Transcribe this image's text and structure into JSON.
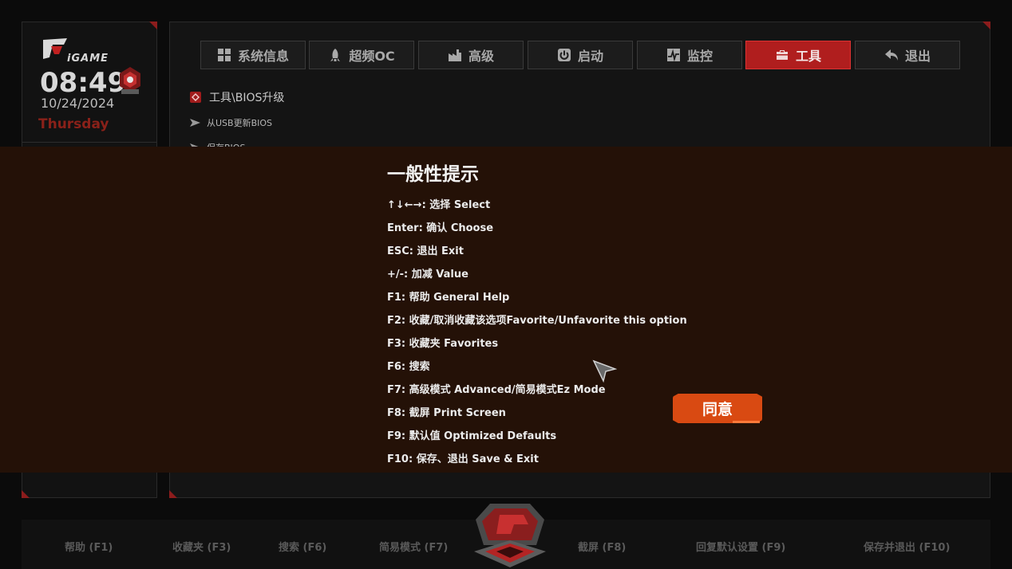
{
  "clock": {
    "brand": "iGAME",
    "time": "08:49",
    "date": "10/24/2024",
    "day": "Thursday"
  },
  "tabs": [
    {
      "label": "系统信息",
      "icon": "grid-icon"
    },
    {
      "label": "超频OC",
      "icon": "rocket-icon"
    },
    {
      "label": "高级",
      "icon": "factory-icon"
    },
    {
      "label": "启动",
      "icon": "power-icon"
    },
    {
      "label": "监控",
      "icon": "monitor-icon"
    },
    {
      "label": "工具",
      "icon": "toolbox-icon",
      "active": true
    },
    {
      "label": "退出",
      "icon": "back-arrow-icon"
    }
  ],
  "breadcrumb": "工具\\BIOS升级",
  "menu": [
    "从USB更新BIOS",
    "保存BIOS"
  ],
  "dialog": {
    "title": "一般性提示",
    "lines": [
      "↑↓←→:  选择 Select",
      "Enter:  确认 Choose",
      "ESC:  退出 Exit",
      "+/-:  加减 Value",
      "F1:  帮助 General Help",
      "F2:  收藏/取消收藏该选项Favorite/Unfavorite this option",
      "F3:  收藏夹 Favorites",
      "F6:  搜索",
      "F7:  高级模式 Advanced/简易模式Ez Mode",
      "F8:  截屏 Print Screen",
      "F9:  默认值 Optimized Defaults",
      "F10:  保存、退出 Save & Exit"
    ],
    "agree": "同意"
  },
  "footer": [
    "帮助 (F1)",
    "收藏夹 (F3)",
    "搜索 (F6)",
    "简易模式 (F7)",
    "截屏 (F8)",
    "回复默认设置 (F9)",
    "保存并退出 (F10)"
  ],
  "colors": {
    "accent_red": "#b01e1e",
    "dialog_bg": "#241107",
    "agree_orange": "#d94a12",
    "day_red": "#8a2119"
  }
}
